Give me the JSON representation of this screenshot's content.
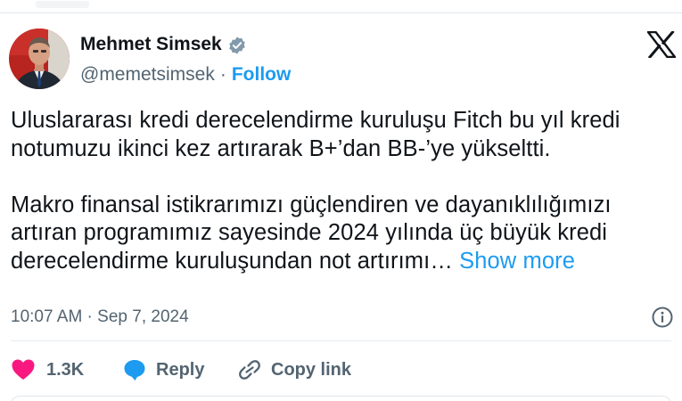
{
  "author": {
    "name": "Mehmet Simsek",
    "handle": "@memetsimsek",
    "follow_label": "Follow",
    "separator": "·"
  },
  "tweet": {
    "paragraph_1": "Uluslararası kredi derecelendirme kuruluşu Fitch bu yıl kredi notumuzu ikinci kez artırarak B+’dan BB-’ye yükseltti.",
    "paragraph_2": "Makro finansal istikrarımızı güçlendiren ve dayanıklılığımızı artıran programımız sayesinde 2024 yılında üç büyük kredi derecelendirme kuruluşundan not artırımı…",
    "show_more_label": "Show more",
    "timestamp": "10:07 AM · Sep 7, 2024"
  },
  "actions": {
    "likes": "1.3K",
    "reply_label": "Reply",
    "copy_link_label": "Copy link"
  },
  "icons": {
    "verified": "verified-badge-icon",
    "brand": "x-logo-icon",
    "info": "info-icon",
    "like": "heart-icon",
    "reply": "reply-bubble-icon",
    "copy": "link-icon"
  },
  "colors": {
    "link": "#1d9bf0",
    "secondary_text": "#536471",
    "like": "#f91880",
    "verified": "#829aab"
  }
}
